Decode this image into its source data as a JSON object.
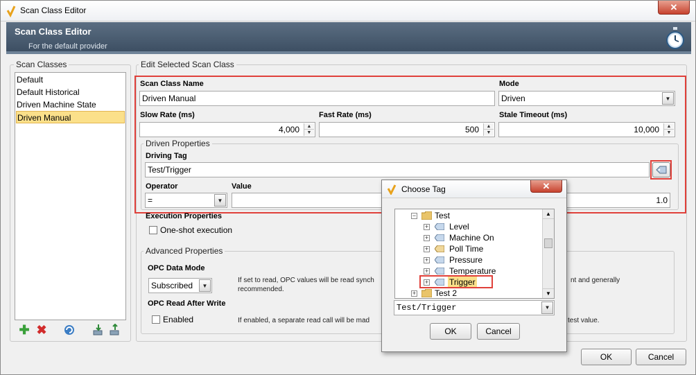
{
  "window": {
    "title": "Scan Class Editor",
    "close_glyph": "✕"
  },
  "banner": {
    "title": "Scan Class Editor",
    "subtitle": "For the default provider"
  },
  "scan_classes": {
    "group_label": "Scan Classes",
    "items": [
      "Default",
      "Default Historical",
      "Driven Machine State",
      "Driven Manual"
    ],
    "selected_index": 3
  },
  "toolbar_icons": [
    "add-icon",
    "delete-icon",
    "refresh-icon",
    "import-icon",
    "export-icon"
  ],
  "edit": {
    "group_label": "Edit Selected Scan Class",
    "name_label": "Scan Class Name",
    "name_value": "Driven Manual",
    "mode_label": "Mode",
    "mode_value": "Driven",
    "slow_rate_label": "Slow Rate (ms)",
    "slow_rate_value": "4,000",
    "fast_rate_label": "Fast Rate (ms)",
    "fast_rate_value": "500",
    "stale_label": "Stale Timeout (ms)",
    "stale_value": "10,000",
    "driven_group_label": "Driven Properties",
    "driving_tag_label": "Driving Tag",
    "driving_tag_value": "Test/Trigger",
    "operator_label": "Operator",
    "operator_value": "=",
    "value_label": "Value",
    "value_value": "1.0",
    "exec_label": "Execution Properties",
    "oneshot_label": "One-shot execution"
  },
  "advanced": {
    "group_label": "Advanced Properties",
    "opc_mode_label": "OPC Data Mode",
    "opc_mode_value": "Subscribed",
    "opc_mode_help_a": "If set to read, OPC values will be read synch",
    "opc_mode_help_b": "nt and generally",
    "opc_mode_help_c": "recommended.",
    "read_after_label": "OPC Read After Write",
    "enabled_label": "Enabled",
    "read_after_help_a": "If enabled, a separate read call will be mad",
    "read_after_help_b": "test value."
  },
  "footer": {
    "ok": "OK",
    "cancel": "Cancel"
  },
  "choose_tag": {
    "title": "Choose Tag",
    "tree": [
      {
        "label": "Test",
        "kind": "folder",
        "level": 0
      },
      {
        "label": "Level",
        "kind": "tag",
        "level": 1
      },
      {
        "label": "Machine On",
        "kind": "tag",
        "level": 1
      },
      {
        "label": "Poll Time",
        "kind": "tag",
        "level": 1
      },
      {
        "label": "Pressure",
        "kind": "tag",
        "level": 1
      },
      {
        "label": "Temperature",
        "kind": "tag",
        "level": 1
      },
      {
        "label": "Trigger",
        "kind": "tag",
        "level": 1,
        "selected": true
      },
      {
        "label": "Test 2",
        "kind": "folder",
        "level": 0
      }
    ],
    "path_value": "Test/Trigger",
    "ok": "OK",
    "cancel": "Cancel"
  },
  "colors": {
    "highlight": "#e0403a",
    "selection": "#fbe08a",
    "banner": "#4a5d72"
  }
}
